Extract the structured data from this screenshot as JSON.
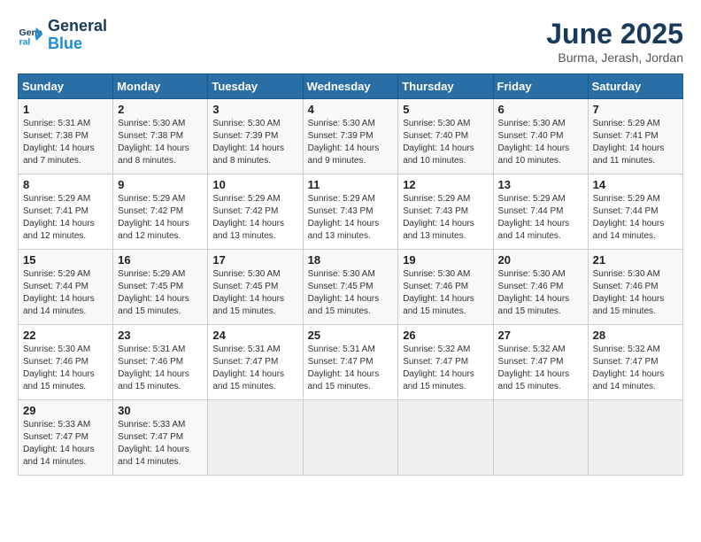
{
  "logo": {
    "line1": "General",
    "line2": "Blue"
  },
  "title": "June 2025",
  "subtitle": "Burma, Jerash, Jordan",
  "days_header": [
    "Sunday",
    "Monday",
    "Tuesday",
    "Wednesday",
    "Thursday",
    "Friday",
    "Saturday"
  ],
  "weeks": [
    [
      {
        "day": "1",
        "info": "Sunrise: 5:31 AM\nSunset: 7:38 PM\nDaylight: 14 hours\nand 7 minutes."
      },
      {
        "day": "2",
        "info": "Sunrise: 5:30 AM\nSunset: 7:38 PM\nDaylight: 14 hours\nand 8 minutes."
      },
      {
        "day": "3",
        "info": "Sunrise: 5:30 AM\nSunset: 7:39 PM\nDaylight: 14 hours\nand 8 minutes."
      },
      {
        "day": "4",
        "info": "Sunrise: 5:30 AM\nSunset: 7:39 PM\nDaylight: 14 hours\nand 9 minutes."
      },
      {
        "day": "5",
        "info": "Sunrise: 5:30 AM\nSunset: 7:40 PM\nDaylight: 14 hours\nand 10 minutes."
      },
      {
        "day": "6",
        "info": "Sunrise: 5:30 AM\nSunset: 7:40 PM\nDaylight: 14 hours\nand 10 minutes."
      },
      {
        "day": "7",
        "info": "Sunrise: 5:29 AM\nSunset: 7:41 PM\nDaylight: 14 hours\nand 11 minutes."
      }
    ],
    [
      {
        "day": "8",
        "info": "Sunrise: 5:29 AM\nSunset: 7:41 PM\nDaylight: 14 hours\nand 12 minutes."
      },
      {
        "day": "9",
        "info": "Sunrise: 5:29 AM\nSunset: 7:42 PM\nDaylight: 14 hours\nand 12 minutes."
      },
      {
        "day": "10",
        "info": "Sunrise: 5:29 AM\nSunset: 7:42 PM\nDaylight: 14 hours\nand 13 minutes."
      },
      {
        "day": "11",
        "info": "Sunrise: 5:29 AM\nSunset: 7:43 PM\nDaylight: 14 hours\nand 13 minutes."
      },
      {
        "day": "12",
        "info": "Sunrise: 5:29 AM\nSunset: 7:43 PM\nDaylight: 14 hours\nand 13 minutes."
      },
      {
        "day": "13",
        "info": "Sunrise: 5:29 AM\nSunset: 7:44 PM\nDaylight: 14 hours\nand 14 minutes."
      },
      {
        "day": "14",
        "info": "Sunrise: 5:29 AM\nSunset: 7:44 PM\nDaylight: 14 hours\nand 14 minutes."
      }
    ],
    [
      {
        "day": "15",
        "info": "Sunrise: 5:29 AM\nSunset: 7:44 PM\nDaylight: 14 hours\nand 14 minutes."
      },
      {
        "day": "16",
        "info": "Sunrise: 5:29 AM\nSunset: 7:45 PM\nDaylight: 14 hours\nand 15 minutes."
      },
      {
        "day": "17",
        "info": "Sunrise: 5:30 AM\nSunset: 7:45 PM\nDaylight: 14 hours\nand 15 minutes."
      },
      {
        "day": "18",
        "info": "Sunrise: 5:30 AM\nSunset: 7:45 PM\nDaylight: 14 hours\nand 15 minutes."
      },
      {
        "day": "19",
        "info": "Sunrise: 5:30 AM\nSunset: 7:46 PM\nDaylight: 14 hours\nand 15 minutes."
      },
      {
        "day": "20",
        "info": "Sunrise: 5:30 AM\nSunset: 7:46 PM\nDaylight: 14 hours\nand 15 minutes."
      },
      {
        "day": "21",
        "info": "Sunrise: 5:30 AM\nSunset: 7:46 PM\nDaylight: 14 hours\nand 15 minutes."
      }
    ],
    [
      {
        "day": "22",
        "info": "Sunrise: 5:30 AM\nSunset: 7:46 PM\nDaylight: 14 hours\nand 15 minutes."
      },
      {
        "day": "23",
        "info": "Sunrise: 5:31 AM\nSunset: 7:46 PM\nDaylight: 14 hours\nand 15 minutes."
      },
      {
        "day": "24",
        "info": "Sunrise: 5:31 AM\nSunset: 7:47 PM\nDaylight: 14 hours\nand 15 minutes."
      },
      {
        "day": "25",
        "info": "Sunrise: 5:31 AM\nSunset: 7:47 PM\nDaylight: 14 hours\nand 15 minutes."
      },
      {
        "day": "26",
        "info": "Sunrise: 5:32 AM\nSunset: 7:47 PM\nDaylight: 14 hours\nand 15 minutes."
      },
      {
        "day": "27",
        "info": "Sunrise: 5:32 AM\nSunset: 7:47 PM\nDaylight: 14 hours\nand 15 minutes."
      },
      {
        "day": "28",
        "info": "Sunrise: 5:32 AM\nSunset: 7:47 PM\nDaylight: 14 hours\nand 14 minutes."
      }
    ],
    [
      {
        "day": "29",
        "info": "Sunrise: 5:33 AM\nSunset: 7:47 PM\nDaylight: 14 hours\nand 14 minutes."
      },
      {
        "day": "30",
        "info": "Sunrise: 5:33 AM\nSunset: 7:47 PM\nDaylight: 14 hours\nand 14 minutes."
      },
      {
        "day": "",
        "info": ""
      },
      {
        "day": "",
        "info": ""
      },
      {
        "day": "",
        "info": ""
      },
      {
        "day": "",
        "info": ""
      },
      {
        "day": "",
        "info": ""
      }
    ]
  ]
}
